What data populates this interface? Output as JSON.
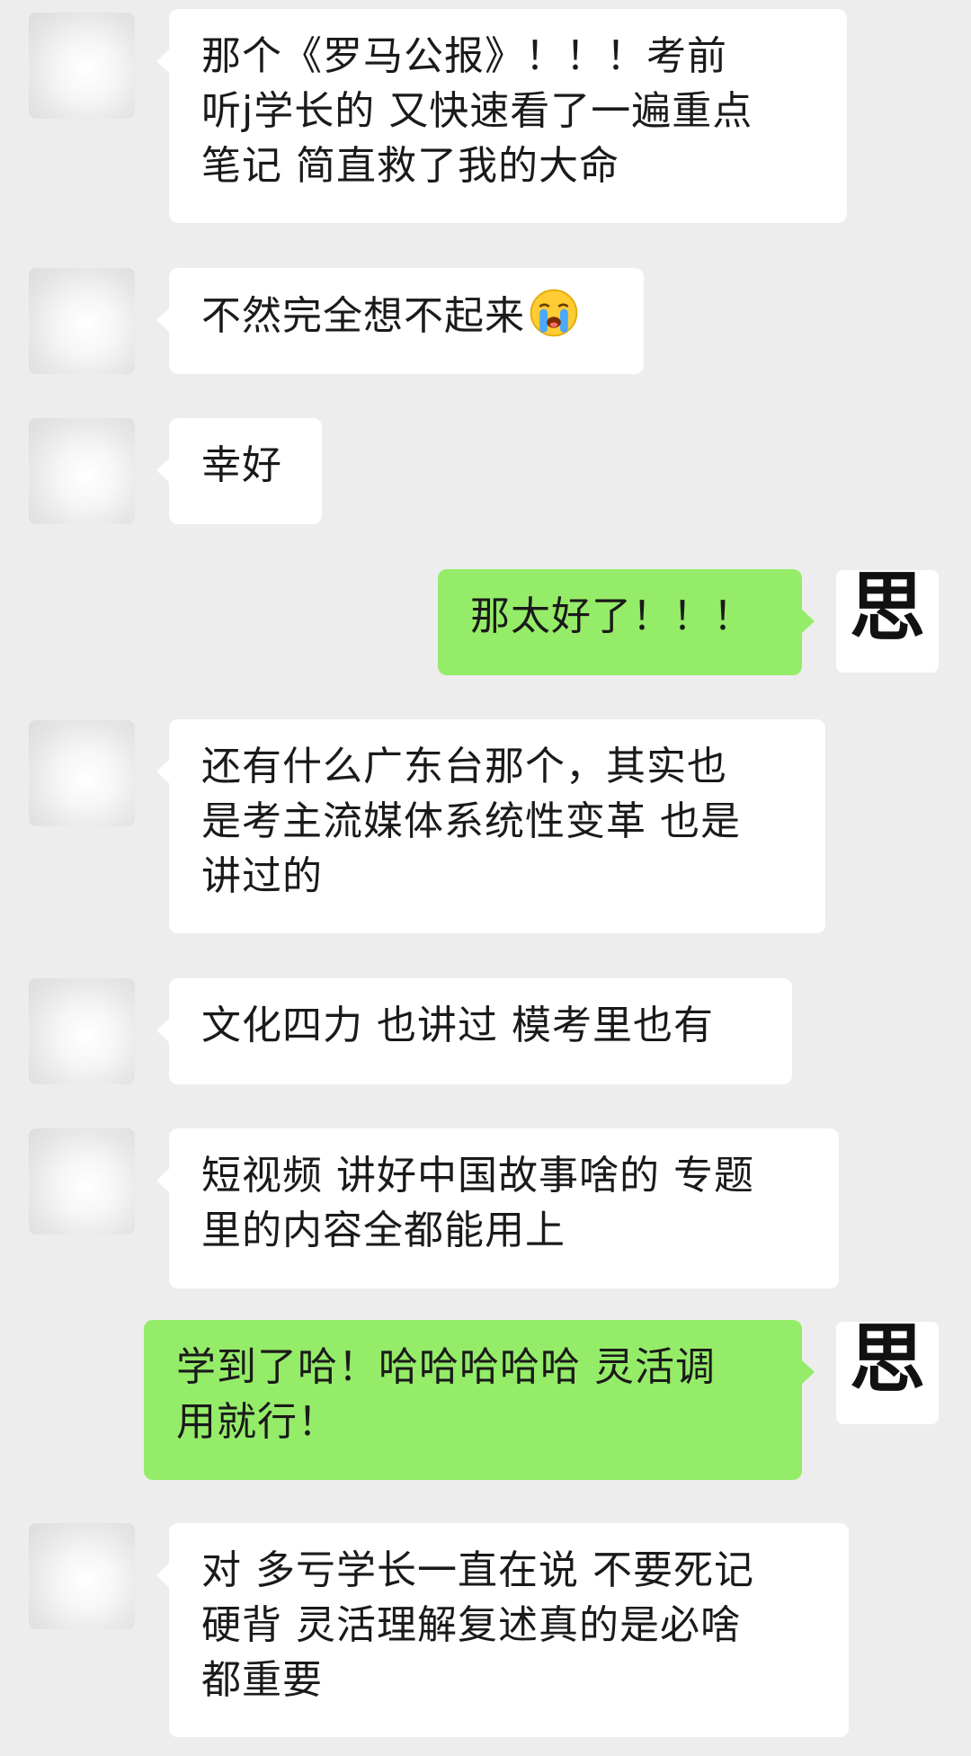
{
  "messages": [
    {
      "side": "in",
      "lines": [
        "那个《罗马公报》！！！考前",
        "听j学长的 又快速看了一遍重点",
        "笔记 简直救了我的大命"
      ]
    },
    {
      "side": "in",
      "lines": [
        "不然完全想不起来"
      ],
      "emoji": "crying-face-emoji"
    },
    {
      "side": "in",
      "lines": [
        "幸好"
      ]
    },
    {
      "side": "out",
      "lines": [
        "那太好了！！！"
      ]
    },
    {
      "side": "in",
      "lines": [
        "还有什么广东台那个，其实也",
        "是考主流媒体系统性变革 也是",
        "讲过的"
      ]
    },
    {
      "side": "in",
      "lines": [
        "文化四力 也讲过 模考里也有"
      ]
    },
    {
      "side": "in",
      "lines": [
        "短视频 讲好中国故事啥的 专题",
        "里的内容全都能用上"
      ]
    },
    {
      "side": "out",
      "lines": [
        "学到了哈！哈哈哈哈哈 灵活调",
        "用就行！"
      ]
    },
    {
      "side": "in",
      "lines": [
        "对  多亏学长一直在说 不要死记",
        "硬背 灵活理解复述真的是必啥",
        "都重要"
      ]
    }
  ],
  "self_avatar": {
    "glyph": "思"
  },
  "colors": {
    "background": "#ededed",
    "incoming_bubble": "#ffffff",
    "outgoing_bubble": "#95ec69",
    "text": "#1a1a1a"
  }
}
